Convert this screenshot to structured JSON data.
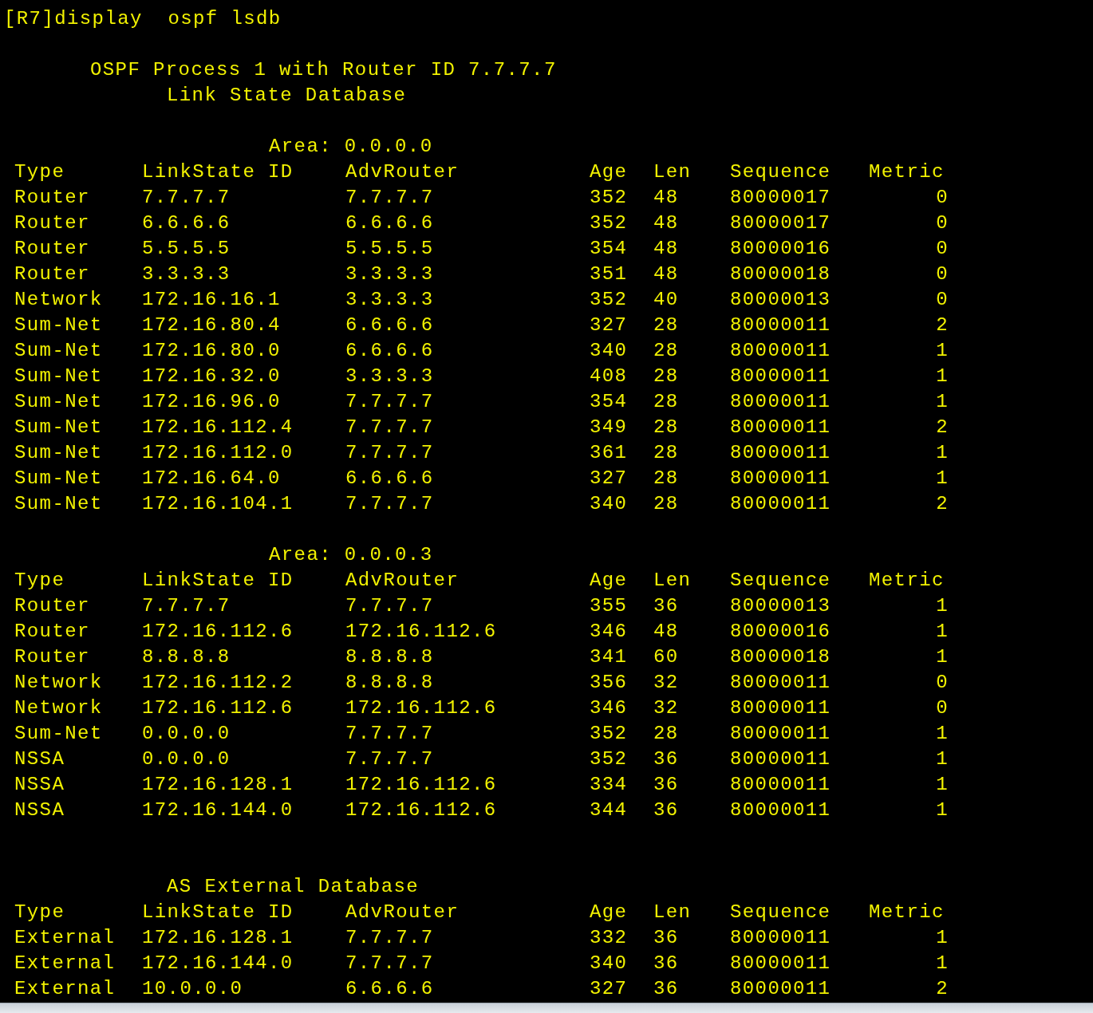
{
  "command": "[R7]display  ospf lsdb",
  "title": "OSPF Process 1 with Router ID 7.7.7.7",
  "subtitle": "Link State Database",
  "sections": [
    {
      "kind": "area",
      "heading": "Area: 0.0.0.0",
      "columns": [
        "Type",
        "LinkState ID",
        "AdvRouter",
        "Age",
        "Len",
        "Sequence",
        "Metric"
      ],
      "rows": [
        [
          "Router",
          "7.7.7.7",
          "7.7.7.7",
          "352",
          "48",
          "80000017",
          "0"
        ],
        [
          "Router",
          "6.6.6.6",
          "6.6.6.6",
          "352",
          "48",
          "80000017",
          "0"
        ],
        [
          "Router",
          "5.5.5.5",
          "5.5.5.5",
          "354",
          "48",
          "80000016",
          "0"
        ],
        [
          "Router",
          "3.3.3.3",
          "3.3.3.3",
          "351",
          "48",
          "80000018",
          "0"
        ],
        [
          "Network",
          "172.16.16.1",
          "3.3.3.3",
          "352",
          "40",
          "80000013",
          "0"
        ],
        [
          "Sum-Net",
          "172.16.80.4",
          "6.6.6.6",
          "327",
          "28",
          "80000011",
          "2"
        ],
        [
          "Sum-Net",
          "172.16.80.0",
          "6.6.6.6",
          "340",
          "28",
          "80000011",
          "1"
        ],
        [
          "Sum-Net",
          "172.16.32.0",
          "3.3.3.3",
          "408",
          "28",
          "80000011",
          "1"
        ],
        [
          "Sum-Net",
          "172.16.96.0",
          "7.7.7.7",
          "354",
          "28",
          "80000011",
          "1"
        ],
        [
          "Sum-Net",
          "172.16.112.4",
          "7.7.7.7",
          "349",
          "28",
          "80000011",
          "2"
        ],
        [
          "Sum-Net",
          "172.16.112.0",
          "7.7.7.7",
          "361",
          "28",
          "80000011",
          "1"
        ],
        [
          "Sum-Net",
          "172.16.64.0",
          "6.6.6.6",
          "327",
          "28",
          "80000011",
          "1"
        ],
        [
          "Sum-Net",
          "172.16.104.1",
          "7.7.7.7",
          "340",
          "28",
          "80000011",
          "2"
        ]
      ]
    },
    {
      "kind": "area",
      "heading": "Area: 0.0.0.3",
      "columns": [
        "Type",
        "LinkState ID",
        "AdvRouter",
        "Age",
        "Len",
        "Sequence",
        "Metric"
      ],
      "rows": [
        [
          "Router",
          "7.7.7.7",
          "7.7.7.7",
          "355",
          "36",
          "80000013",
          "1"
        ],
        [
          "Router",
          "172.16.112.6",
          "172.16.112.6",
          "346",
          "48",
          "80000016",
          "1"
        ],
        [
          "Router",
          "8.8.8.8",
          "8.8.8.8",
          "341",
          "60",
          "80000018",
          "1"
        ],
        [
          "Network",
          "172.16.112.2",
          "8.8.8.8",
          "356",
          "32",
          "80000011",
          "0"
        ],
        [
          "Network",
          "172.16.112.6",
          "172.16.112.6",
          "346",
          "32",
          "80000011",
          "0"
        ],
        [
          "Sum-Net",
          "0.0.0.0",
          "7.7.7.7",
          "352",
          "28",
          "80000011",
          "1"
        ],
        [
          "NSSA",
          "0.0.0.0",
          "7.7.7.7",
          "352",
          "36",
          "80000011",
          "1"
        ],
        [
          "NSSA",
          "172.16.128.1",
          "172.16.112.6",
          "334",
          "36",
          "80000011",
          "1"
        ],
        [
          "NSSA",
          "172.16.144.0",
          "172.16.112.6",
          "344",
          "36",
          "80000011",
          "1"
        ]
      ]
    },
    {
      "kind": "external",
      "heading": "AS External Database",
      "columns": [
        "Type",
        "LinkState ID",
        "AdvRouter",
        "Age",
        "Len",
        "Sequence",
        "Metric"
      ],
      "rows": [
        [
          "External",
          "172.16.128.1",
          "7.7.7.7",
          "332",
          "36",
          "80000011",
          "1"
        ],
        [
          "External",
          "172.16.144.0",
          "7.7.7.7",
          "340",
          "36",
          "80000011",
          "1"
        ],
        [
          "External",
          "10.0.0.0",
          "6.6.6.6",
          "327",
          "36",
          "80000011",
          "2"
        ]
      ]
    }
  ]
}
